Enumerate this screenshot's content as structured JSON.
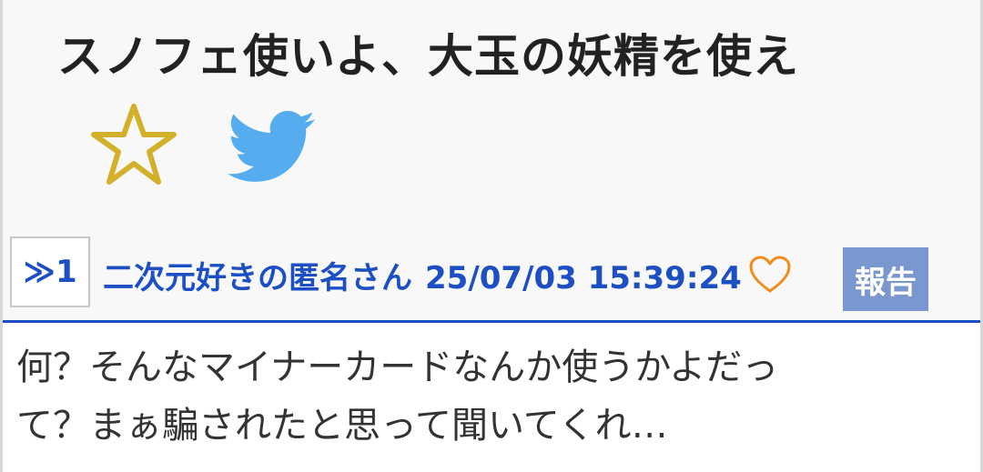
{
  "thread": {
    "title": "スノフェ使いよ、大玉の妖精を使え"
  },
  "actions": {
    "favorite_icon": "star-outline-icon",
    "favorite_color": "#d4b02a",
    "share_icon": "twitter-icon",
    "share_color": "#55acee"
  },
  "post": {
    "anchor": "≫1",
    "author": "二次元好きの匿名さん",
    "datetime": "25/07/03 15:39:24",
    "like_icon": "heart-outline-icon",
    "like_color": "#f28c1c",
    "report_label": "報告",
    "body_lines": [
      "何？そんなマイナーカードなんか使うかよだっ",
      "て？まぁ騙されたと思って聞いてくれ…"
    ]
  },
  "colors": {
    "accent": "#1c4fc4",
    "report_bg": "#7a98cf",
    "header_bg": "#f8f8f8"
  }
}
